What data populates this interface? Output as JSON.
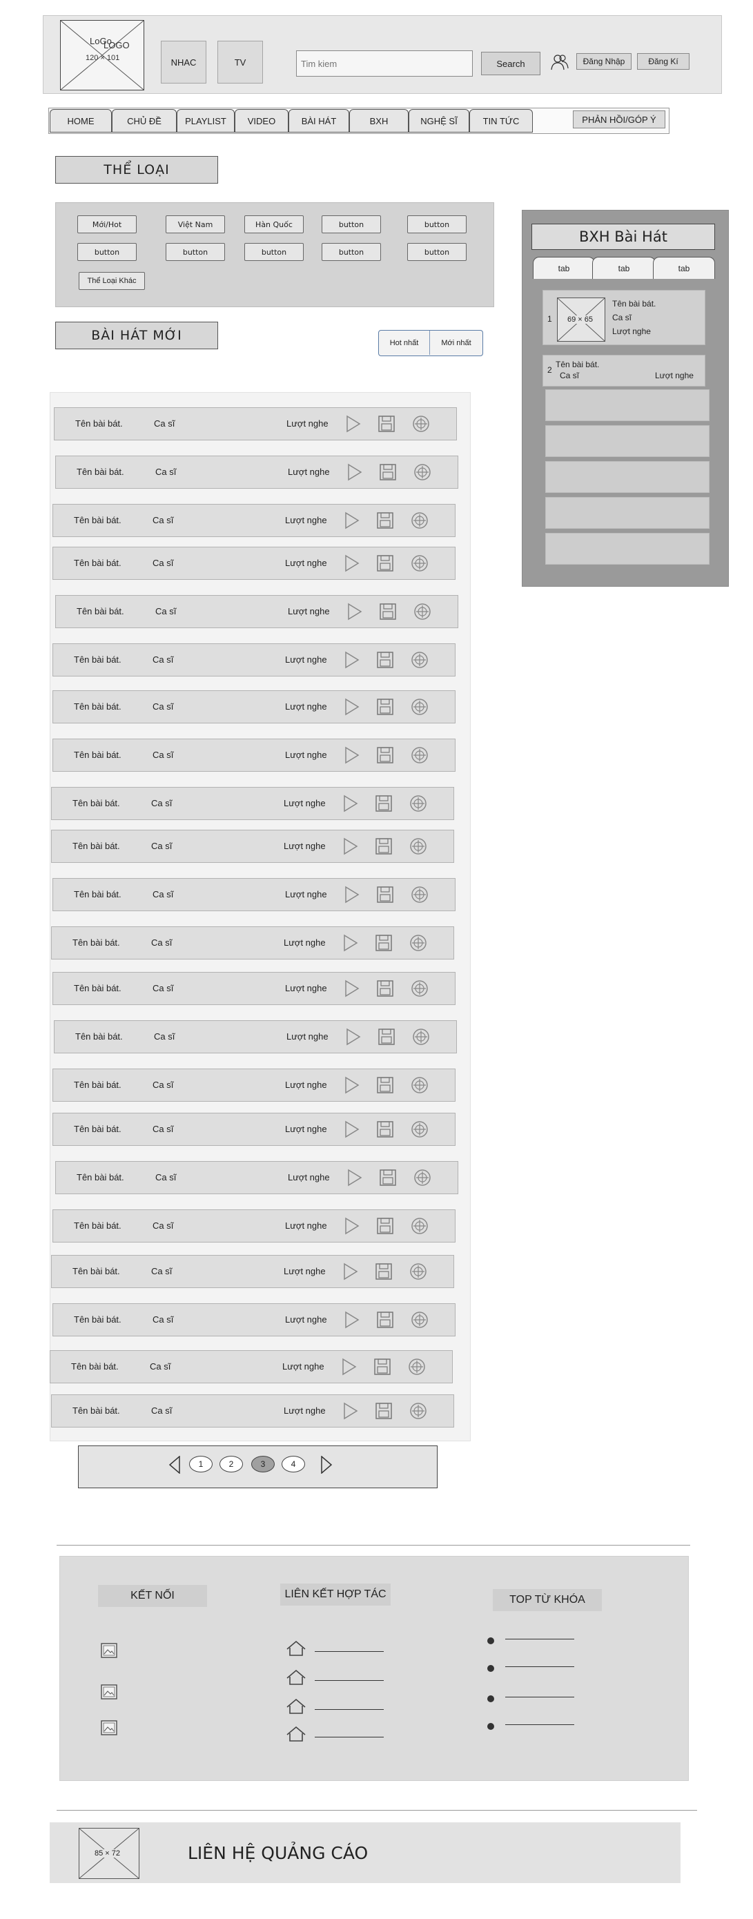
{
  "header": {
    "logo_line1": "LoGo",
    "logo_line2": "LOGO",
    "logo_size": "120 × 101",
    "nav_nhac": "NHAC",
    "nav_tv": "TV",
    "search_placeholder": "Tim kiem",
    "search_button": "Search",
    "login": "Đăng Nhập",
    "register": "Đăng Kí"
  },
  "menu": {
    "items": [
      "HOME",
      "CHỦ ĐỀ",
      "PLAYLIST",
      "VIDEO",
      "BÀI HÁT",
      "BXH",
      "NGHỆ SĨ",
      "TIN TỨC"
    ],
    "feedback": "PHẢN HỒI/GÓP Ý"
  },
  "categories": {
    "title": "THỂ LOẠI",
    "buttons": [
      "Mới/Hot",
      "Việt Nam",
      "Hàn Quốc",
      "button",
      "button",
      "button",
      "button",
      "button",
      "button",
      "button"
    ],
    "other": "Thể Loại Khác"
  },
  "new_songs": {
    "title": "BÀI HÁT MỚI",
    "sort_hot": "Hot nhất",
    "sort_new": "Mới nhất",
    "song_label": "Tên bài bát.",
    "artist_label": "Ca sĩ",
    "plays_label": "Lượt nghe",
    "row_count": 22
  },
  "pagination": {
    "pages": [
      "1",
      "2",
      "3",
      "4"
    ],
    "current": "3"
  },
  "chart": {
    "title": "BXH Bài Hát",
    "tabs": [
      "tab",
      "tab",
      "tab"
    ],
    "first": {
      "rank": "1",
      "image_size": "69 × 65",
      "song": "Tên bài bát.",
      "artist": "Ca sĩ",
      "plays": "Lượt nghe"
    },
    "second": {
      "rank": "2",
      "song": "Tên bài bát.",
      "artist": "Ca sĩ",
      "plays": "Lượt nghe"
    }
  },
  "footer": {
    "connect_title": "KẾT NỐI",
    "partners_title": "LIÊN KẾT HỢP TÁC",
    "keywords_title": "TOP TỪ KHÓA",
    "ad_image_size": "85 × 72",
    "ad_text": "LIÊN HỆ QUẢNG CÁO"
  },
  "colors": {
    "panel": "#e7e7e7",
    "sidebar": "#9a9a9a",
    "active_page": "#a0a0a0"
  }
}
